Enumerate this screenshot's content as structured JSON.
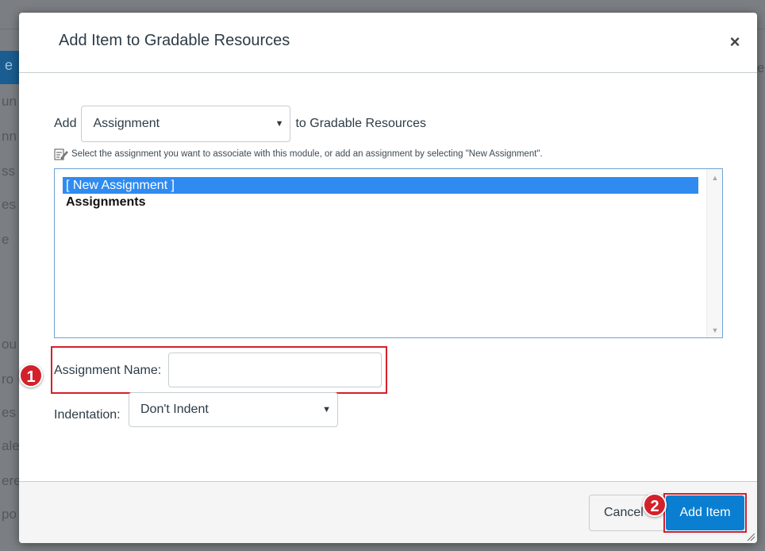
{
  "background": {
    "fragments": [
      "e",
      "un",
      "nn",
      "ss",
      "es",
      "e",
      "ou",
      "ro",
      "es",
      "ale",
      "ere",
      "po",
      "e"
    ]
  },
  "modal": {
    "title": "Add Item to Gradable Resources",
    "close_symbol": "×",
    "add_prefix": "Add",
    "item_type": {
      "selected": "Assignment",
      "arrow": "▼"
    },
    "add_suffix": "to Gradable Resources",
    "hint_text": "Select the assignment you want to associate with this module, or add an assignment by selecting \"New Assignment\".",
    "list": {
      "options": [
        {
          "label": "[ New Assignment ]",
          "selected": true
        },
        {
          "label": "Assignments",
          "selected": false
        }
      ],
      "scroll_up": "▲",
      "scroll_down": "▼"
    },
    "assignment_name": {
      "label": "Assignment Name:",
      "value": ""
    },
    "indentation": {
      "label": "Indentation:",
      "selected": "Don't Indent",
      "arrow": "▼"
    },
    "footer": {
      "cancel_label": "Cancel",
      "add_label": "Add Item"
    }
  },
  "callouts": {
    "step1": "1",
    "step2": "2"
  },
  "colors": {
    "primary": "#0a7fd1",
    "selection": "#2f8bf0",
    "callout_red": "#d3212b",
    "overlay": "#7b7f83"
  }
}
